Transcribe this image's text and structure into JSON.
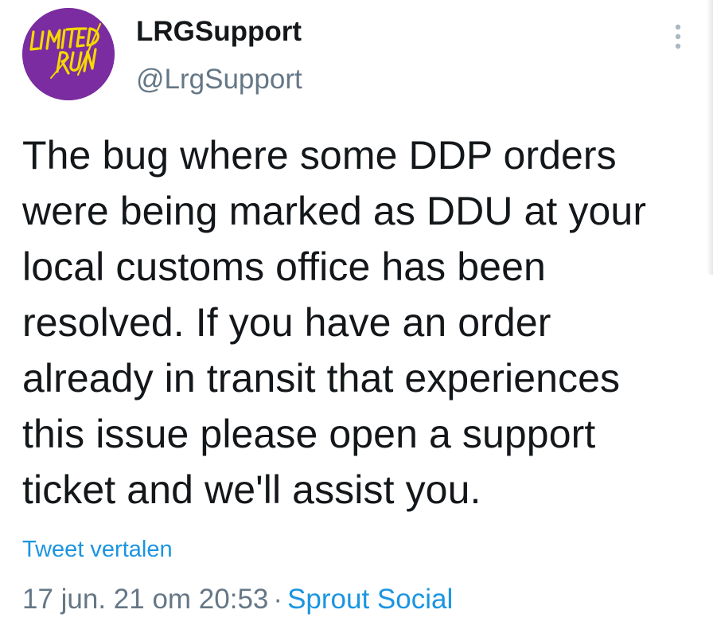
{
  "author": {
    "display_name": "LRGSupport",
    "handle": "@LrgSupport",
    "avatar_logo_text": "LIMITED RUN",
    "avatar_bg_color": "#7a2ca0",
    "avatar_text_color": "#f5d800"
  },
  "more_icon": "more-vertical-icon",
  "tweet": {
    "text": "The bug where some DDP orders were being marked as DDU at your local customs office has been resolved. If you have an order already in transit that experiences this issue please open a support ticket and we'll assist you.",
    "translate_label": "Tweet vertalen",
    "timestamp": "17 jun. 21 om 20:53",
    "separator": "·",
    "source": "Sprout Social"
  },
  "colors": {
    "text": "#14171a",
    "secondary": "#657786",
    "link": "#1b95e0"
  }
}
